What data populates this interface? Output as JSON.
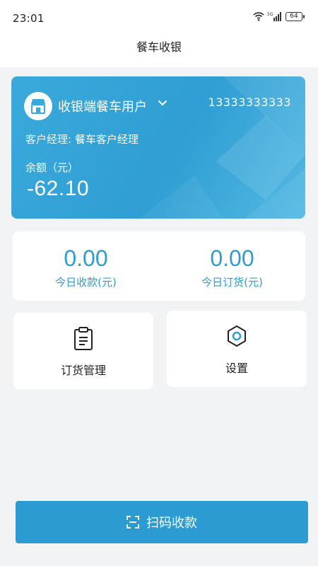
{
  "status_bar": {
    "time": "23:01",
    "network": "5G",
    "battery": "64"
  },
  "header": {
    "title": "餐车收银"
  },
  "account": {
    "user_name": "收银端餐车用户",
    "phone": "13333333333",
    "manager_label": "客户经理:",
    "manager_name": "餐车客户经理",
    "balance_label": "余额（元）",
    "balance_value": "-62.10"
  },
  "stats": [
    {
      "value": "0.00",
      "label": "今日收款(元)"
    },
    {
      "value": "0.00",
      "label": "今日订货(元)"
    }
  ],
  "tiles": {
    "order_management": {
      "label": "订货管理",
      "icon": "clipboard-icon"
    },
    "settings": {
      "label": "设置",
      "icon": "gear-icon"
    }
  },
  "scan_button": {
    "label": "扫码收款",
    "icon": "scan-icon"
  },
  "colors": {
    "accent": "#2f9dcf",
    "card_blue": "#3aa9db",
    "button_blue": "#2b9bd2",
    "background": "#f2f3f5"
  }
}
